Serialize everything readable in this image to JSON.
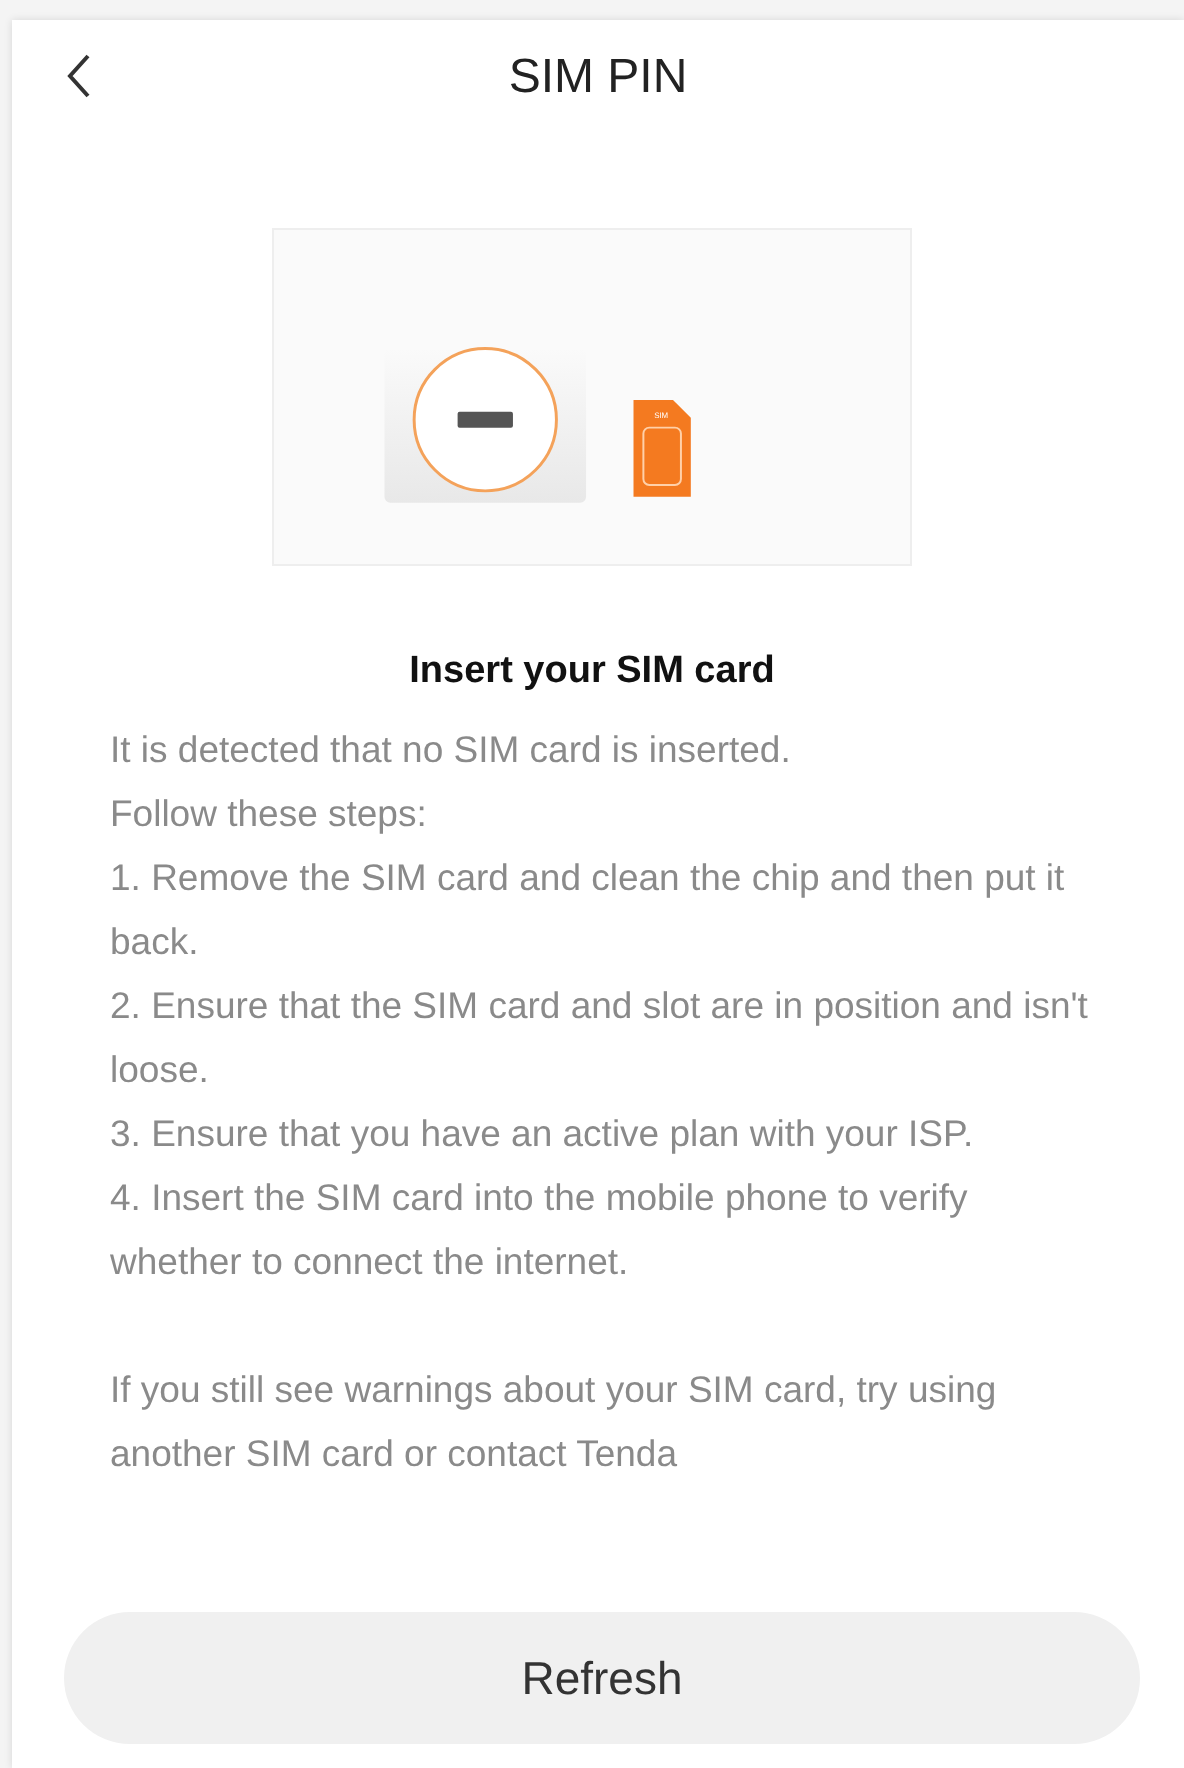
{
  "header": {
    "title": "SIM PIN"
  },
  "illustration": {
    "card_label": "SIM"
  },
  "heading": "Insert your SIM card",
  "intro": [
    "It is detected that no SIM card is inserted.",
    "Follow these steps:"
  ],
  "steps": [
    "1. Remove the SIM card and clean the chip and then put it back.",
    "2. Ensure that the SIM card and slot are in position and isn't loose.",
    "3. Ensure that you have an active plan with your ISP.",
    "4. Insert the SIM card into the mobile phone to verify whether to connect the internet."
  ],
  "note": "If you still see warnings about your SIM card, try using another SIM card or contact Tenda",
  "button": "Refresh"
}
